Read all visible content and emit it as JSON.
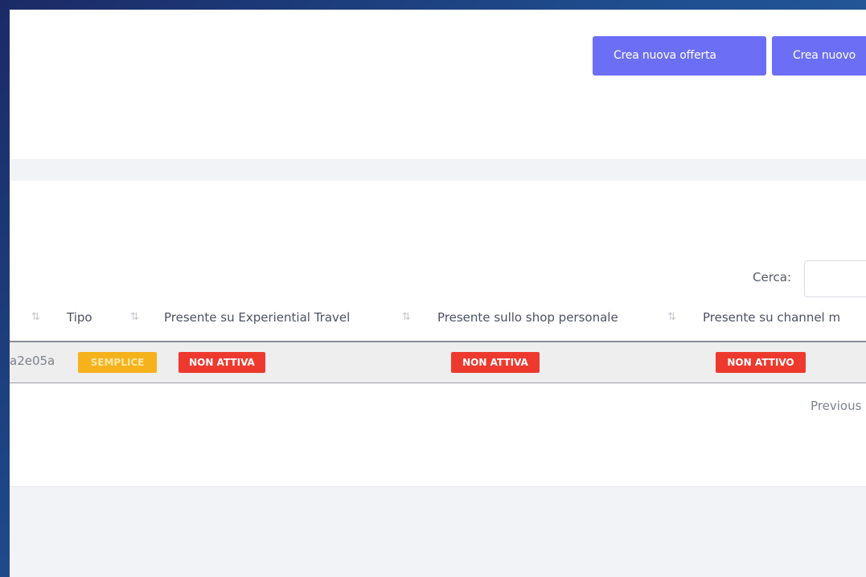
{
  "header": {
    "buttons": {
      "create_offer": "Crea nuova offerta",
      "create_new": "Crea nuovo"
    }
  },
  "table": {
    "search_label": "Cerca:",
    "search_value": "",
    "columns": [
      "Tipo",
      "Presente su Experiential Travel",
      "Presente sullo shop personale",
      "Presente su channel m"
    ],
    "rows": [
      {
        "id": "a2e05a",
        "tipo": "SEMPLICE",
        "experiential_travel": "NON ATTIVA",
        "shop_personale": "NON ATTIVA",
        "channel_manager": "NON ATTIVO"
      }
    ],
    "pager_previous": "Previous"
  },
  "colors": {
    "accent": "#6c6ff5",
    "badge_warning": "#f6b21b",
    "badge_danger": "#ee3a2e",
    "background": "#f2f3f7"
  },
  "icons": [
    "sort-icon"
  ]
}
